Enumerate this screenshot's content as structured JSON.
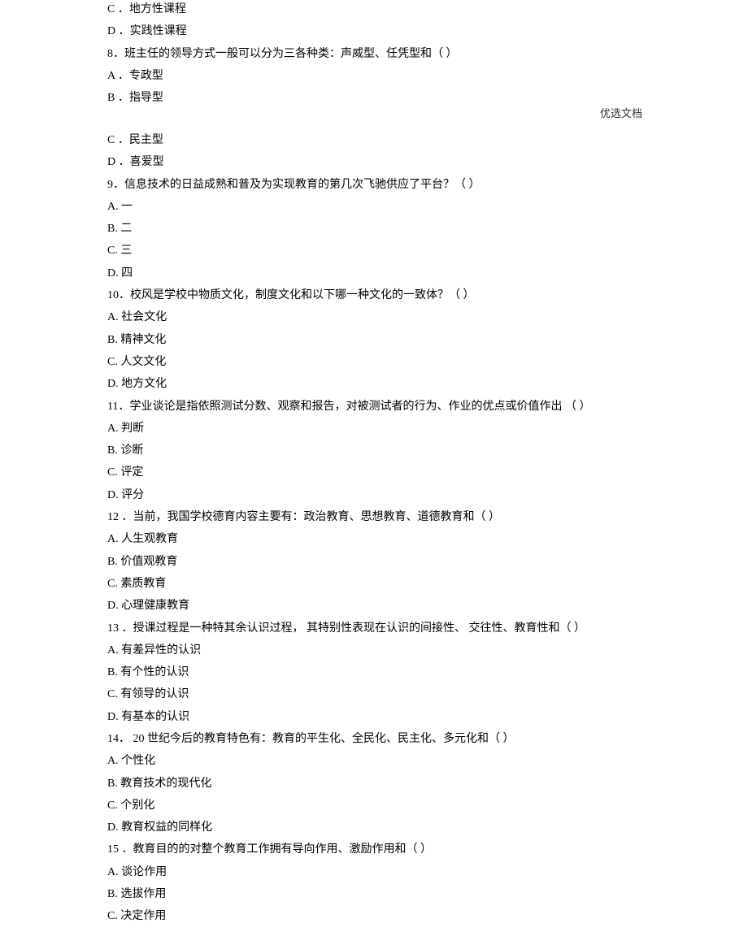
{
  "header_note": "优选文档",
  "lines": [
    "C ．地方性课程",
    "D ．实践性课程",
    "8．班主任的领导方式一般可以分为三各种类：声威型、任凭型和（             ）",
    "A ．专政型",
    "B ．指导型",
    "",
    "C ．民主型",
    "D ．喜爱型",
    "9．信息技术的日益成熟和普及为实现教育的第几次飞驰供应了平台？（             ）",
    "A. 一",
    "B. 二",
    "C. 三",
    "D. 四",
    "10．校风是学校中物质文化，制度文化和以下哪一种文化的一致体？（  ）",
    "A. 社会文化",
    "B. 精神文化",
    "C. 人文文化",
    "D. 地方文化",
    "11．学业谈论是指依照测试分数、观察和报告，对被测试者的行为、作业的优点或价值作出 （  ）",
    "A. 判断",
    "B. 诊断",
    "C. 评定",
    "D. 评分",
    "12 ．当前，我国学校德育内容主要有：政治教育、思想教育、道德教育和（  ）",
    "A. 人生观教育",
    "B. 价值观教育",
    "C. 素质教育",
    "D. 心理健康教育",
    "13 ．授课过程是一种特其余认识过程，  其特别性表现在认识的间接性、  交往性、教育性和（   ）",
    "A. 有差异性的认识",
    "B. 有个性的认识",
    "C. 有领导的认识",
    "D. 有基本的认识",
    "14．  20 世纪今后的教育特色有：教育的平生化、全民化、民主化、多元化和（   ）",
    "A. 个性化",
    "B. 教育技术的现代化",
    "C. 个别化",
    "D. 教育权益的同样化",
    "15 ．教育目的的对整个教育工作拥有导向作用、激励作用和（  ）",
    "A. 谈论作用",
    "B. 选拔作用",
    "C. 决定作用"
  ]
}
